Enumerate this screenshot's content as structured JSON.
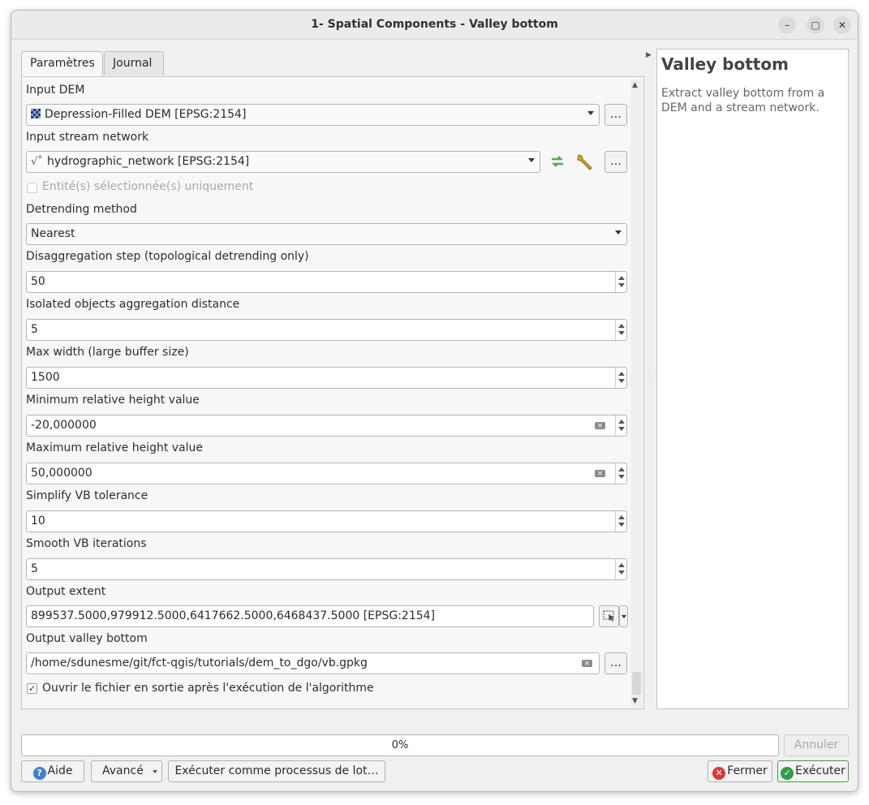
{
  "window": {
    "title": "1- Spatial Components - Valley bottom"
  },
  "tabs": [
    {
      "label": "Paramètres",
      "active": true
    },
    {
      "label": "Journal",
      "active": false
    }
  ],
  "params": {
    "input_dem": {
      "label": "Input DEM",
      "value": "Depression-Filled DEM [EPSG:2154]",
      "more": "…"
    },
    "input_stream": {
      "label": "Input stream network",
      "value": "hydrographic_network [EPSG:2154]",
      "more": "…"
    },
    "selected_only": {
      "label": "Entité(s) sélectionnée(s) uniquement",
      "checked": false
    },
    "detrending": {
      "label": "Detrending method",
      "value": "Nearest"
    },
    "disaggregation": {
      "label": "Disaggregation step (topological detrending only)",
      "value": "50"
    },
    "isolated": {
      "label": "Isolated objects aggregation distance",
      "value": "5"
    },
    "max_width": {
      "label": "Max width (large buffer size)",
      "value": "1500"
    },
    "min_height": {
      "label": "Minimum relative height value",
      "value": "-20,000000"
    },
    "max_height": {
      "label": "Maximum relative height value",
      "value": "50,000000"
    },
    "simplify": {
      "label": "Simplify VB tolerance",
      "value": "10"
    },
    "smooth": {
      "label": "Smooth VB iterations",
      "value": "5"
    },
    "extent": {
      "label": "Output extent",
      "value": "899537.5000,979912.5000,6417662.5000,6468437.5000 [EPSG:2154]"
    },
    "output": {
      "label": "Output valley bottom",
      "value": "/home/sdunesme/git/fct-qgis/tutorials/dem_to_dgo/vb.gpkg",
      "more": "…"
    },
    "open_after": {
      "label": "Ouvrir le fichier en sortie après l'exécution de l'algorithme",
      "checked": true
    }
  },
  "help": {
    "title": "Valley bottom",
    "description": "Extract valley bottom from a DEM and a stream network."
  },
  "progress": {
    "text": "0%",
    "value": 0
  },
  "buttons": {
    "cancel": "Annuler",
    "help": "Aide",
    "advanced": "Avancé",
    "batch": "Exécuter comme processus de lot…",
    "close": "Fermer",
    "run": "Exécuter"
  },
  "colors": {
    "accent_green": "#4caf50",
    "close_red": "#d63b3b",
    "help_blue": "#3d7fd6"
  }
}
